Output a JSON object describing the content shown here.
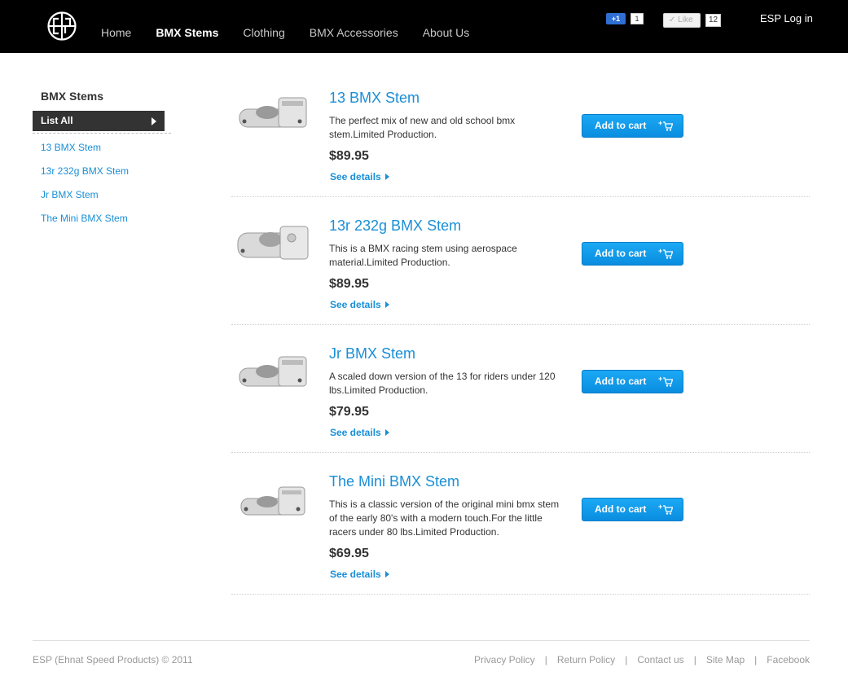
{
  "header": {
    "logo_text": "ESP",
    "nav": [
      {
        "label": "Home",
        "active": false
      },
      {
        "label": "BMX Stems",
        "active": true
      },
      {
        "label": "Clothing",
        "active": false
      },
      {
        "label": "BMX Accessories",
        "active": false
      },
      {
        "label": "About Us",
        "active": false
      }
    ],
    "gplus_label": "+1",
    "gplus_count": "1",
    "like_label": "Like",
    "like_count": "12",
    "login_label": "ESP Log in"
  },
  "sidebar": {
    "title": "BMX Stems",
    "list_all": "List All",
    "items": [
      "13 BMX Stem",
      "13r 232g BMX Stem",
      "Jr BMX Stem",
      "The Mini BMX Stem"
    ]
  },
  "products": [
    {
      "title": "13 BMX Stem",
      "desc": "The perfect mix of new and old school bmx stem.Limited Production.",
      "price": "$89.95",
      "details": "See details",
      "cart": "Add to cart"
    },
    {
      "title": "13r 232g BMX Stem",
      "desc": "This is a BMX racing stem using aerospace material.Limited Production.",
      "price": "$89.95",
      "details": "See details",
      "cart": "Add to cart"
    },
    {
      "title": "Jr BMX Stem",
      "desc": "A scaled down version of the 13 for riders under 120 lbs.Limited Production.",
      "price": "$79.95",
      "details": "See details",
      "cart": "Add to cart"
    },
    {
      "title": "The Mini BMX Stem",
      "desc": "This is a classic version of the original mini bmx stem of the early 80's with a modern touch.For the little racers under 80 lbs.Limited Production.",
      "price": "$69.95",
      "details": "See details",
      "cart": "Add to cart"
    }
  ],
  "footer": {
    "copyright": "ESP (Ehnat Speed Products) © 2011",
    "links": [
      "Privacy Policy",
      "Return Policy",
      "Contact us",
      "Site Map",
      "Facebook"
    ]
  },
  "colors": {
    "header_bg": "#000000",
    "link_blue": "#1a8fd6",
    "cart_blue": "#0a8de0",
    "sidebar_active_bg": "#333333"
  }
}
